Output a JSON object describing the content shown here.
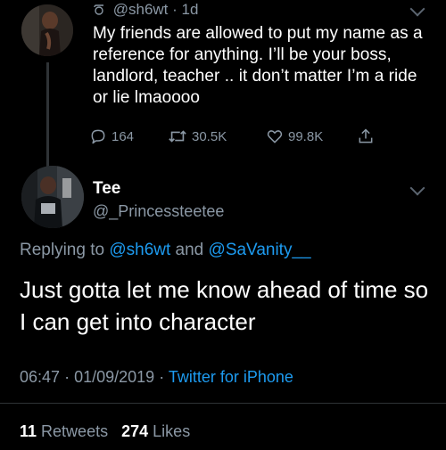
{
  "parent_tweet": {
    "handle": "@sh6wt",
    "separator": "·",
    "time": "1d",
    "body": "My friends are allowed to put my name as a reference for anything. I’ll be your boss, landlord, teacher .. it don’t matter I’m a ride or lie lmaoooo",
    "actions": {
      "replies": "164",
      "retweets": "30.5K",
      "likes": "99.8K"
    }
  },
  "reply_tweet": {
    "name": "Tee",
    "handle": "@_Princessteetee",
    "replying_prefix": "Replying to",
    "replying_user1": "@sh6wt",
    "replying_and": "and",
    "replying_user2": "@SaVanity__",
    "text": "Just gotta let me know ahead of time so I can get into character",
    "time": "06:47",
    "date": "01/09/2019",
    "meta_sep": "·",
    "source": "Twitter for iPhone",
    "retweets_count": "11",
    "retweets_label": "Retweets",
    "likes_count": "274",
    "likes_label": "Likes"
  },
  "colors": {
    "background": "#000000",
    "secondary_text": "#8b98a5",
    "link": "#1d9bf0",
    "divider": "#2f3336"
  },
  "icons": [
    "retweet-small-icon",
    "reply-icon",
    "retweet-icon",
    "like-icon",
    "share-icon",
    "chevron-down-icon"
  ]
}
